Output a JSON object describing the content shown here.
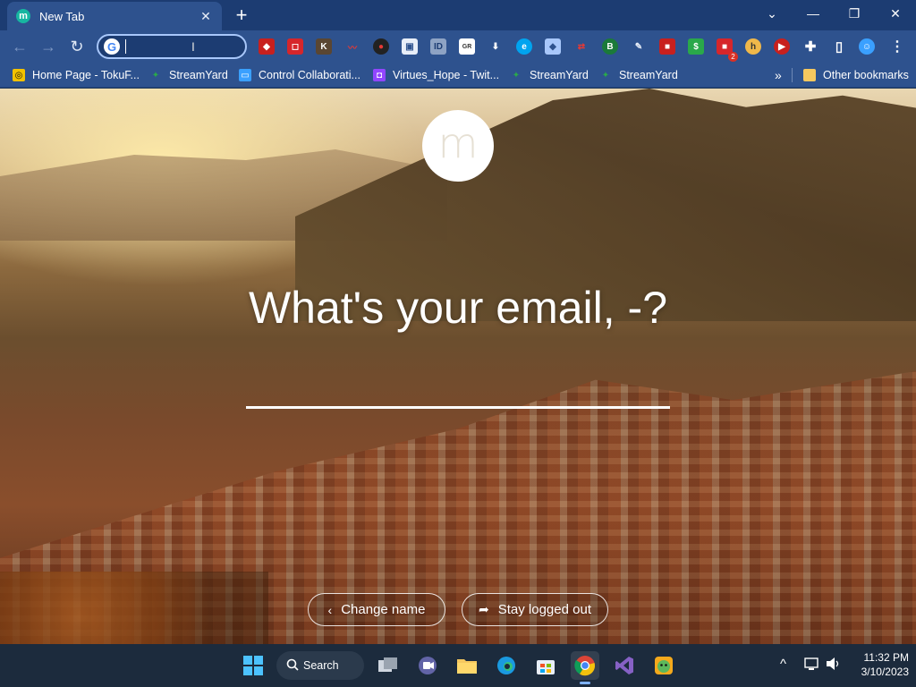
{
  "browser": {
    "tab": {
      "title": "New Tab",
      "favicon_letter": "m"
    },
    "window_controls": [
      "chevron-down-icon",
      "minimize-icon",
      "restore-icon",
      "close-icon"
    ],
    "omnibox": {
      "value": "",
      "search_engine_icon": "G"
    },
    "extension_badge": "2",
    "bookmarks": [
      {
        "label": "Home Page - TokuF...",
        "icon": "tokuf-icon",
        "color": "#f2c200"
      },
      {
        "label": "StreamYard",
        "icon": "streamyard-icon",
        "color": "#2aa84a"
      },
      {
        "label": "Control Collaborati...",
        "icon": "monitor-icon",
        "color": "#3aa0ff"
      },
      {
        "label": "Virtues_Hope - Twit...",
        "icon": "twitch-icon",
        "color": "#9146ff"
      },
      {
        "label": "StreamYard",
        "icon": "streamyard-icon",
        "color": "#2aa84a"
      },
      {
        "label": "StreamYard",
        "icon": "streamyard-icon",
        "color": "#2aa84a"
      }
    ],
    "bookmarks_overflow": "»",
    "other_bookmarks": "Other bookmarks"
  },
  "page": {
    "logo_letter": "m",
    "question": "What's your email, -?",
    "email_value": "",
    "change_name_label": "Change name",
    "stay_logged_out_label": "Stay logged out"
  },
  "taskbar": {
    "search_label": "Search",
    "clock_time": "11:32 PM",
    "clock_date": "3/10/2023"
  },
  "colors": {
    "titlebar": "#1c3c72",
    "toolbar": "#2e528e",
    "taskbar": "#1c2b3d",
    "omnibox_focus": "#a8c7fa"
  }
}
